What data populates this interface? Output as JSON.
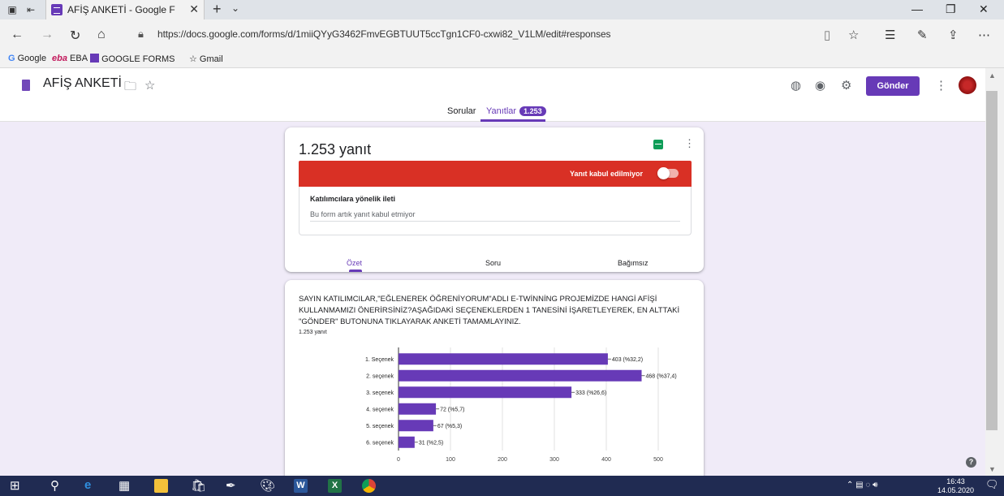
{
  "browser": {
    "tab_title": "AFİŞ ANKETİ - Google F",
    "url": "https://docs.google.com/forms/d/1miiQYyG3462FmvEGBTUUT5ccTgn1CF0-cxwi82_V1LM/edit#responses",
    "bookmarks": [
      "Google",
      "EBA",
      "GOOGLE FORMS",
      "Gmail"
    ]
  },
  "form": {
    "title": "AFİŞ ANKETİ",
    "send_label": "Gönder",
    "tabs": {
      "questions": "Sorular",
      "responses": "Yanıtlar",
      "responses_count": "1.253"
    }
  },
  "summary_card": {
    "title": "1.253 yanıt",
    "status_label": "Yanıt kabul edilmiyor",
    "accepting_responses": false,
    "message_label": "Katılımcılara yönelik ileti",
    "message_value": "Bu form artık yanıt kabul etmiyor",
    "subtabs": [
      "Özet",
      "Soru",
      "Bağımsız"
    ],
    "active_subtab": "Özet"
  },
  "question_card": {
    "question": "SAYIN KATILIMCILAR,\"EĞLENEREK ÖĞRENİYORUM\"ADLI E-TWİNNİNG PROJEMİZDE HANGİ AFİŞİ KULLANMAMIZI ÖNERİRSİNİZ?AŞAĞIDAKİ SEÇENEKLERDEN 1 TANESİNİ İŞARETLEYEREK, EN ALTTAKİ \"GÖNDER\" BUTONUNA TIKLAYARAK ANKETİ TAMAMLAYINIZ.",
    "response_count": "1.253 yanıt"
  },
  "chart_data": {
    "type": "bar",
    "orientation": "horizontal",
    "categories": [
      "1. Seçenek",
      "2. seçenek",
      "3. seçenek",
      "4. seçenek",
      "5. seçenek",
      "6. seçenek"
    ],
    "values": [
      403,
      468,
      333,
      72,
      67,
      31
    ],
    "data_labels": [
      "403 (%32,2)",
      "468 (%37,4)",
      "333 (%26,6)",
      "72 (%5,7)",
      "67 (%5,3)",
      "31 (%2,5)"
    ],
    "xlim": [
      0,
      500
    ],
    "xticks": [
      0,
      100,
      200,
      300,
      400,
      500
    ],
    "grid": true,
    "color": "#673ab7"
  },
  "taskbar": {
    "time": "16:43",
    "date": "14.05.2020"
  },
  "colors": {
    "accent": "#673ab7",
    "closed_bar": "#d93025",
    "background": "#f0ebf8"
  }
}
